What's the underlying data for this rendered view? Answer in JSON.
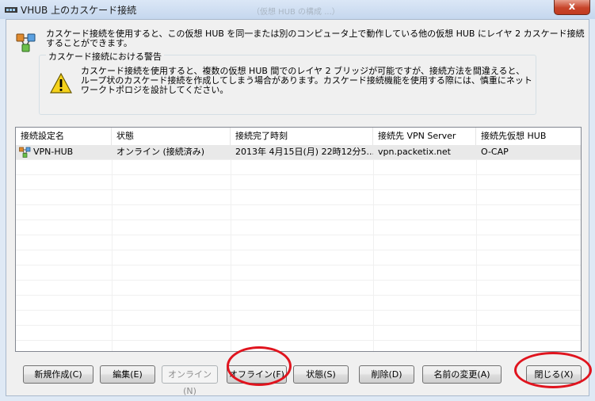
{
  "window": {
    "title": "VHUB 上のカスケード接続",
    "close_label": "x",
    "background_title": "（仮想 HUB の構成 ...）"
  },
  "description": "カスケード接続を使用すると、この仮想 HUB を同一または別のコンピュータ上で動作している他の仮想 HUB にレイヤ 2 カスケード接続することができます。",
  "warning": {
    "legend": "カスケード接続における警告",
    "text": "カスケード接続を使用すると、複数の仮想 HUB 間でのレイヤ 2 ブリッジが可能ですが、接続方法を間違えると、ループ状のカスケード接続を作成してしまう場合があります。カスケード接続機能を使用する際には、慎重にネットワークトポロジを設計してください。"
  },
  "table": {
    "columns": [
      "接続設定名",
      "状態",
      "接続完了時刻",
      "接続先 VPN Server",
      "接続先仮想 HUB"
    ],
    "rows": [
      {
        "name": "VPN-HUB",
        "status": "オンライン (接続済み)",
        "time": "2013年 4月15日(月) 22時12分5...",
        "server": "vpn.packetix.net",
        "hub": "O-CAP",
        "icon": "cascade-link-icon"
      }
    ]
  },
  "buttons": {
    "new": "新規作成(C)",
    "edit": "編集(E)",
    "online": "オンライン(N)",
    "offline": "オフライン(F)",
    "status": "状態(S)",
    "delete": "削除(D)",
    "rename": "名前の変更(A)",
    "close": "閉じる(X)"
  },
  "annotations": {
    "color": "#e0141e",
    "circled": [
      "offline",
      "close"
    ]
  },
  "colors": {
    "selected_row": "#e9e9e9",
    "close_button": "#c7442a",
    "warning_yellow": "#f5d21b"
  }
}
